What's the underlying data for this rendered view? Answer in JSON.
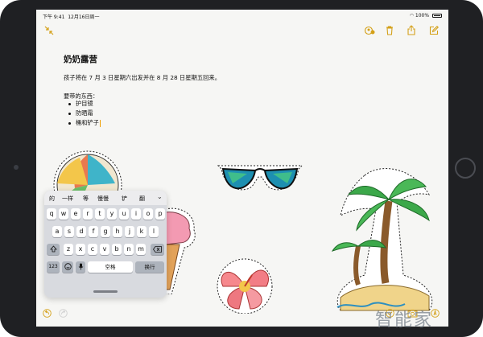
{
  "status": {
    "time": "下午 9:41",
    "date": "12月16日周一",
    "battery": "100%"
  },
  "note": {
    "title": "奶奶露营",
    "line1": "孩子将在 7 月 3 日星期六出发并在 8 月 28 日星期五回来。",
    "list_header": "要带的东西：",
    "items": [
      "护目镜",
      "防晒霜",
      "桶和铲子"
    ]
  },
  "toolbar": {
    "icons": [
      "collapse-icon",
      "share-user-icon",
      "trash-icon",
      "share-icon",
      "compose-icon"
    ]
  },
  "keyboard": {
    "candidates": [
      "的",
      "一样",
      "等",
      "慢慢",
      "铲",
      "翻"
    ],
    "row1": [
      "q",
      "w",
      "e",
      "r",
      "t",
      "y",
      "u",
      "i",
      "o",
      "p"
    ],
    "row2": [
      "a",
      "s",
      "d",
      "f",
      "g",
      "h",
      "j",
      "k",
      "l"
    ],
    "row3": [
      "z",
      "x",
      "c",
      "v",
      "b",
      "n",
      "m"
    ],
    "num_key": "123",
    "space_key": "空格",
    "return_key": "换行"
  },
  "watermark": "智能家",
  "colors": {
    "accent": "#d4a017",
    "keyboard_bg": "#d8dadf"
  }
}
